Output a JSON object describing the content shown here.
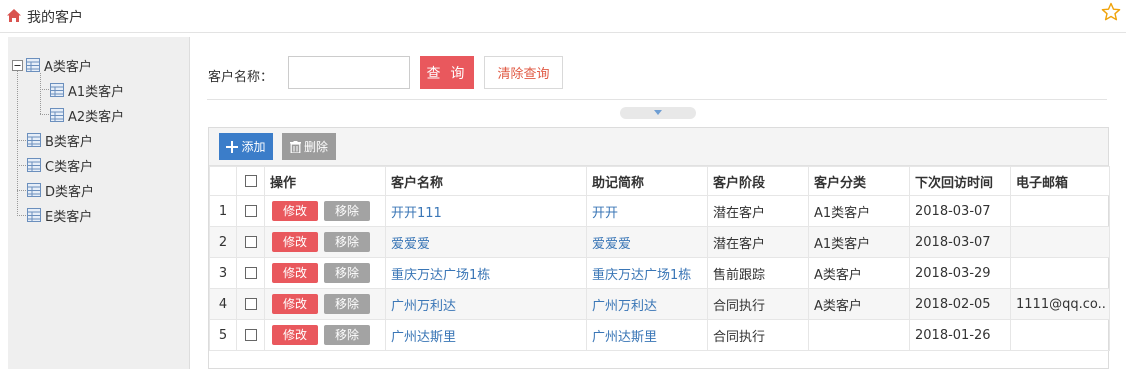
{
  "header": {
    "title": "我的客户"
  },
  "tree": {
    "nodes": [
      {
        "label": "A类客户"
      },
      {
        "label": "A1类客户"
      },
      {
        "label": "A2类客户"
      },
      {
        "label": "B类客户"
      },
      {
        "label": "C类客户"
      },
      {
        "label": "D类客户"
      },
      {
        "label": "E类客户"
      }
    ]
  },
  "search": {
    "label": "客户名称：",
    "value": "",
    "query_button": "查 询",
    "clear_button": "清除查询"
  },
  "toolbar": {
    "add_label": "添加",
    "delete_label": "删除"
  },
  "table": {
    "columns": [
      "",
      "",
      "操作",
      "客户名称",
      "助记简称",
      "客户阶段",
      "客户分类",
      "下次回访时间",
      "电子邮箱"
    ],
    "edit_label": "修改",
    "remove_label": "移除",
    "rows": [
      {
        "num": "1",
        "name": "开开111",
        "short": "开开",
        "stage": "潜在客户",
        "category": "A1类客户",
        "next_visit": "2018-03-07",
        "email": ""
      },
      {
        "num": "2",
        "name": "爱爱爱",
        "short": "爱爱爱",
        "stage": "潜在客户",
        "category": "A1类客户",
        "next_visit": "2018-03-07",
        "email": ""
      },
      {
        "num": "3",
        "name": "重庆万达广场1栋",
        "short": "重庆万达广场1栋",
        "stage": "售前跟踪",
        "category": "A类客户",
        "next_visit": "2018-03-29",
        "email": ""
      },
      {
        "num": "4",
        "name": "广州万利达",
        "short": "广州万利达",
        "stage": "合同执行",
        "category": "A类客户",
        "next_visit": "2018-02-05",
        "email": "1111@qq.co.."
      },
      {
        "num": "5",
        "name": "广州达斯里",
        "short": "广州达斯里",
        "stage": "合同执行",
        "category": "",
        "next_visit": "2018-01-26",
        "email": ""
      }
    ]
  },
  "colors": {
    "primary_red": "#e9585d",
    "link_blue": "#3a76b6",
    "add_blue": "#3b7dc9"
  }
}
